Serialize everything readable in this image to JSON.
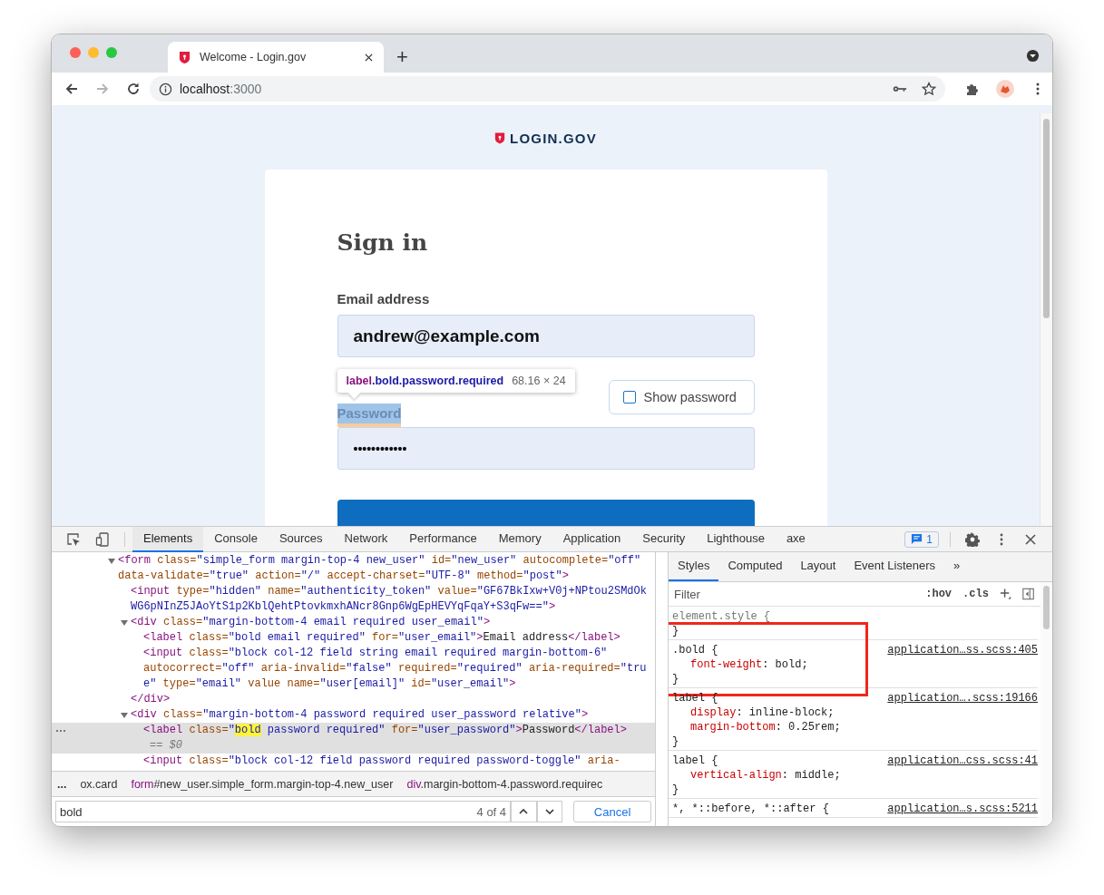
{
  "browser": {
    "tabs": [
      {
        "title": "Welcome - Login.gov",
        "selected": true
      }
    ],
    "new_tab": "+",
    "url_host": "localhost",
    "url_port": ":3000",
    "forward_disabled": true
  },
  "page": {
    "logo": "LOGIN.GOV",
    "heading": "Sign in",
    "email_label": "Email address",
    "email_value": "andrew@example.com",
    "password_label": "Password",
    "password_inspected": true,
    "password_value": "••••••••••••",
    "show_password": {
      "label": "Show password",
      "checked": false
    },
    "tooltip": {
      "tag": "label",
      "classes": ".bold.password.required",
      "size": "68.16 × 24"
    }
  },
  "devtools": {
    "tabs": [
      {
        "label": "Elements",
        "selected": true
      },
      {
        "label": "Console",
        "selected": false
      },
      {
        "label": "Sources",
        "selected": false
      },
      {
        "label": "Network",
        "selected": false
      },
      {
        "label": "Performance",
        "selected": false
      },
      {
        "label": "Memory",
        "selected": false
      },
      {
        "label": "Application",
        "selected": false
      },
      {
        "label": "Security",
        "selected": false
      },
      {
        "label": "Lighthouse",
        "selected": false
      },
      {
        "label": "axe",
        "selected": false
      }
    ],
    "issues_count": "1",
    "selected_suffix": "== $0",
    "dom": [
      {
        "expanded": true,
        "selected": false,
        "parts": [
          {
            "kind": "tag",
            "t": "<form"
          },
          {
            "kind": "attr",
            "t": " class="
          },
          {
            "kind": "val",
            "t": "\"simple_form margin-top-4 new_user\""
          },
          {
            "kind": "attr",
            "t": " id="
          },
          {
            "kind": "val",
            "t": "\"new_user\""
          },
          {
            "kind": "attr",
            "t": " autocomplete="
          },
          {
            "kind": "val",
            "t": "\"off\""
          },
          {
            "kind": "attr",
            "t": " data-validate="
          },
          {
            "kind": "val",
            "t": "\"true\""
          },
          {
            "kind": "attr",
            "t": " action="
          },
          {
            "kind": "val",
            "t": "\"/\""
          },
          {
            "kind": "attr",
            "t": " accept-charset="
          },
          {
            "kind": "val",
            "t": "\"UTF-8\""
          },
          {
            "kind": "attr",
            "t": " method="
          },
          {
            "kind": "val",
            "t": "\"post\""
          },
          {
            "kind": "tag",
            "t": ">"
          }
        ],
        "children": [
          {
            "selected": false,
            "parts": [
              {
                "kind": "tag",
                "t": "<input"
              },
              {
                "kind": "attr",
                "t": " type="
              },
              {
                "kind": "val",
                "t": "\"hidden\""
              },
              {
                "kind": "attr",
                "t": " name="
              },
              {
                "kind": "val",
                "t": "\"authenticity_token\""
              },
              {
                "kind": "attr",
                "t": " value="
              },
              {
                "kind": "val",
                "t": "\"GF67BkIxw+V0j+NPtou2SMdOkWG6pNInZ5JAoYtS1p2KblQehtPtovkmxhANcr8Gnp6WgEpHEVYqFqaY+S3qFw==\""
              },
              {
                "kind": "tag",
                "t": ">"
              }
            ]
          },
          {
            "expanded": true,
            "selected": false,
            "parts": [
              {
                "kind": "tag",
                "t": "<div"
              },
              {
                "kind": "attr",
                "t": " class="
              },
              {
                "kind": "val",
                "t": "\"margin-bottom-4 email required user_email\""
              },
              {
                "kind": "tag",
                "t": ">"
              }
            ],
            "children": [
              {
                "selected": false,
                "parts": [
                  {
                    "kind": "tag",
                    "t": "<label"
                  },
                  {
                    "kind": "attr",
                    "t": " class="
                  },
                  {
                    "kind": "val",
                    "t": "\"bold email required\""
                  },
                  {
                    "kind": "attr",
                    "t": " for="
                  },
                  {
                    "kind": "val",
                    "t": "\"user_email\""
                  },
                  {
                    "kind": "tag",
                    "t": ">"
                  },
                  {
                    "kind": "text",
                    "t": "Email address"
                  },
                  {
                    "kind": "tag",
                    "t": "</label>"
                  }
                ]
              },
              {
                "selected": false,
                "parts": [
                  {
                    "kind": "tag",
                    "t": "<input"
                  },
                  {
                    "kind": "attr",
                    "t": " class="
                  },
                  {
                    "kind": "val",
                    "t": "\"block col-12 field string email required margin-bottom-6\""
                  },
                  {
                    "kind": "attr",
                    "t": " autocorrect="
                  },
                  {
                    "kind": "val",
                    "t": "\"off\""
                  },
                  {
                    "kind": "attr",
                    "t": " aria-invalid="
                  },
                  {
                    "kind": "val",
                    "t": "\"false\""
                  },
                  {
                    "kind": "attr",
                    "t": " required="
                  },
                  {
                    "kind": "val",
                    "t": "\"required\""
                  },
                  {
                    "kind": "attr",
                    "t": " aria-required="
                  },
                  {
                    "kind": "val",
                    "t": "\"true\""
                  },
                  {
                    "kind": "attr",
                    "t": " type="
                  },
                  {
                    "kind": "val",
                    "t": "\"email\""
                  },
                  {
                    "kind": "attr",
                    "t": " value name="
                  },
                  {
                    "kind": "val",
                    "t": "\"user[email]\""
                  },
                  {
                    "kind": "attr",
                    "t": " id="
                  },
                  {
                    "kind": "val",
                    "t": "\"user_email\""
                  },
                  {
                    "kind": "tag",
                    "t": ">"
                  }
                ]
              }
            ],
            "close": [
              {
                "kind": "tag",
                "t": "</div>"
              }
            ]
          },
          {
            "expanded": true,
            "selected": false,
            "parts": [
              {
                "kind": "tag",
                "t": "<div"
              },
              {
                "kind": "attr",
                "t": " class="
              },
              {
                "kind": "val",
                "t": "\"margin-bottom-4 password required user_password relative\""
              },
              {
                "kind": "tag",
                "t": ">"
              }
            ],
            "children": [
              {
                "selected": true,
                "parts": [
                  {
                    "kind": "tag",
                    "t": "<label"
                  },
                  {
                    "kind": "attr",
                    "t": " class="
                  },
                  {
                    "kind": "val",
                    "t": "\""
                  },
                  {
                    "kind": "match",
                    "t": "bold"
                  },
                  {
                    "kind": "val",
                    "t": " password required\""
                  },
                  {
                    "kind": "attr",
                    "t": " for="
                  },
                  {
                    "kind": "val",
                    "t": "\"user_password\""
                  },
                  {
                    "kind": "tag",
                    "t": ">"
                  },
                  {
                    "kind": "text",
                    "t": "Password"
                  },
                  {
                    "kind": "tag",
                    "t": "</label>"
                  }
                ]
              },
              {
                "selected": false,
                "parts": [
                  {
                    "kind": "tag",
                    "t": "<input"
                  },
                  {
                    "kind": "attr",
                    "t": " class="
                  },
                  {
                    "kind": "val",
                    "t": "\"block col-12 field password required password-toggle\""
                  },
                  {
                    "kind": "attr",
                    "t": " aria-"
                  }
                ]
              }
            ]
          }
        ]
      }
    ],
    "breadcrumbs": {
      "more": "...",
      "items": [
        {
          "rest": "ox.card"
        },
        {
          "tag": "form",
          "rest": "#new_user.simple_form.margin-top-4.new_user"
        },
        {
          "tag": "div",
          "rest": ".margin-bottom-4.password.requirec"
        }
      ]
    },
    "search": {
      "value": "bold",
      "count": "4 of 4",
      "cancel": "Cancel"
    },
    "styles_tabs": [
      {
        "label": "Styles",
        "selected": true
      },
      {
        "label": "Computed",
        "selected": false
      },
      {
        "label": "Layout",
        "selected": false
      },
      {
        "label": "Event Listeners",
        "selected": false
      }
    ],
    "styles_more": "»",
    "filter": {
      "placeholder": "Filter",
      "hov": ":hov",
      "cls": ".cls"
    },
    "rules": [
      {
        "selector": "element.style {",
        "close": "}"
      },
      {
        "selector": ".bold {",
        "source": "application…ss.scss:405",
        "declarations": [
          {
            "property": "font-weight",
            "value": ": bold;"
          }
        ],
        "close": "}",
        "annotated": true
      },
      {
        "selector": "label {",
        "source": "application….scss:19166",
        "declarations": [
          {
            "property": "display",
            "value": ": inline-block;"
          },
          {
            "property": "margin-bottom",
            "value": ": 0.25rem;"
          }
        ],
        "close": "}"
      },
      {
        "selector": "label {",
        "source": "application…css.scss:41",
        "declarations": [
          {
            "property": "vertical-align",
            "value": ": middle;"
          }
        ],
        "close": "}"
      },
      {
        "selector": "*, *::before, *::after {",
        "source": "application…s.scss:5211"
      }
    ]
  }
}
